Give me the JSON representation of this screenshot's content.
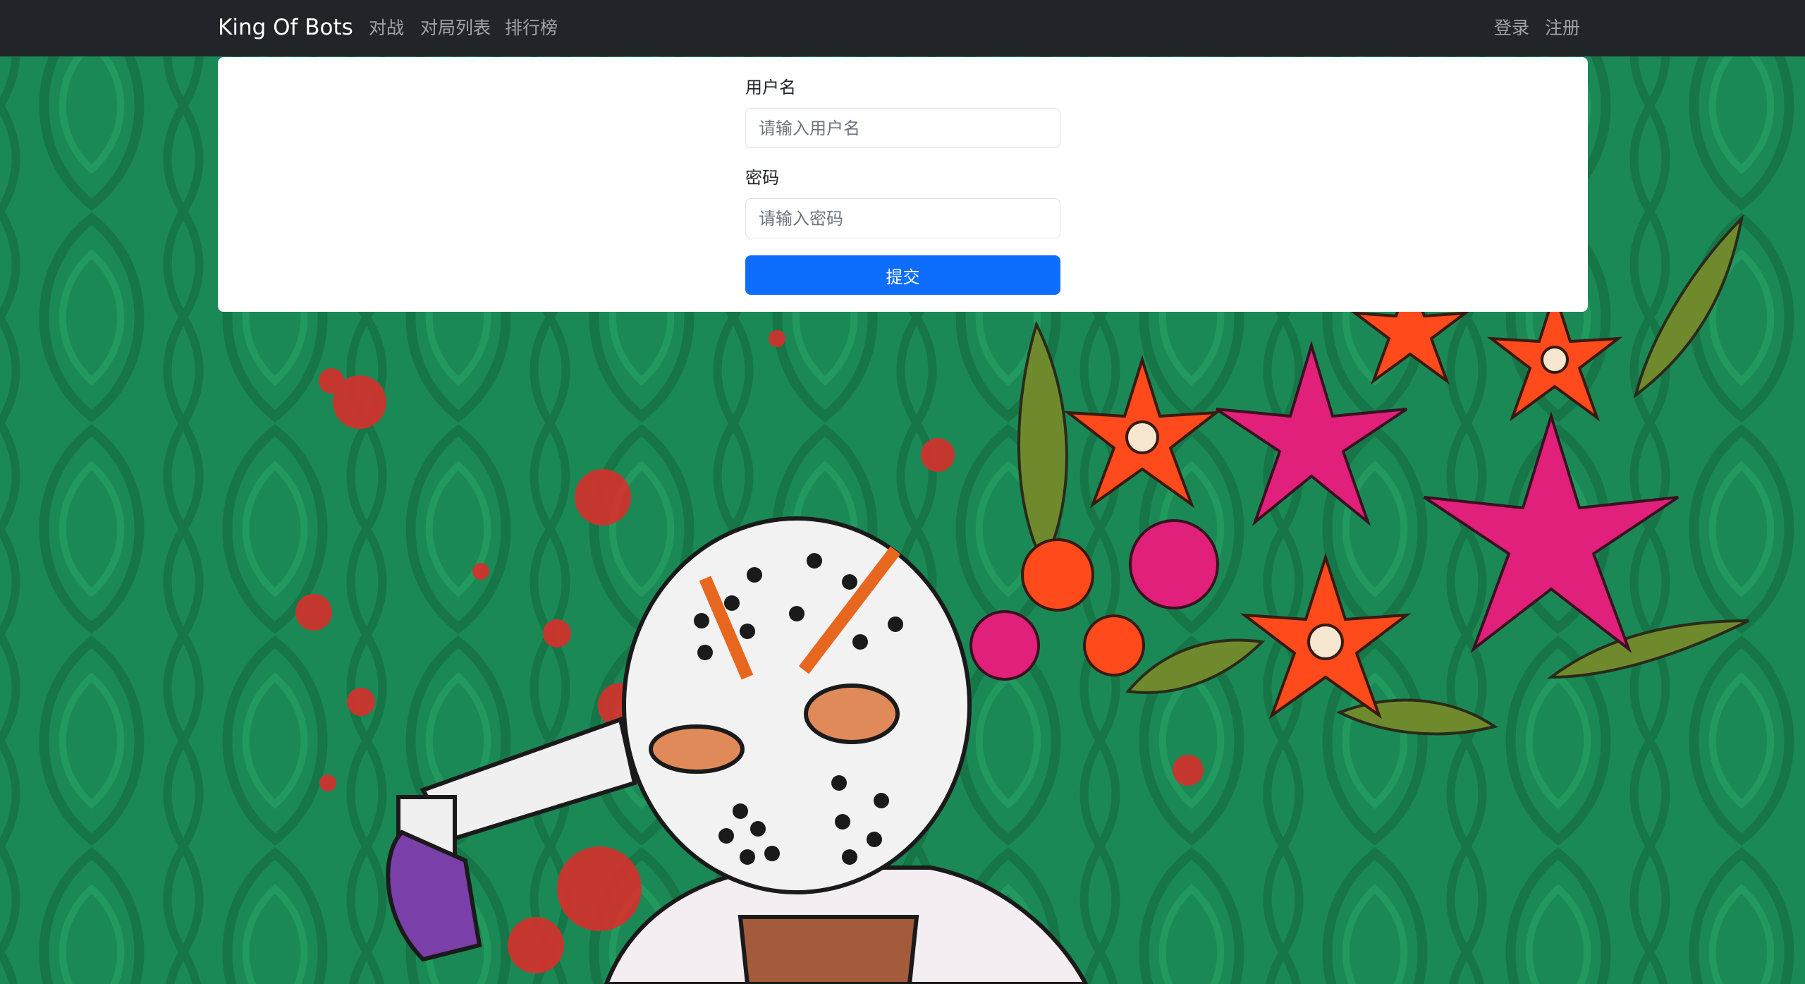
{
  "navbar": {
    "brand": "King Of Bots",
    "links": [
      "对战",
      "对局列表",
      "排行榜"
    ],
    "login": "登录",
    "register": "注册"
  },
  "login_form": {
    "username_label": "用户名",
    "username_placeholder": "请输入用户名",
    "username_value": "",
    "password_label": "密码",
    "password_placeholder": "请输入密码",
    "password_value": "",
    "submit_label": "提交"
  },
  "colors": {
    "navbar_bg": "#212529",
    "background_green": "#1a8a57",
    "primary_button": "#0d6efd"
  }
}
